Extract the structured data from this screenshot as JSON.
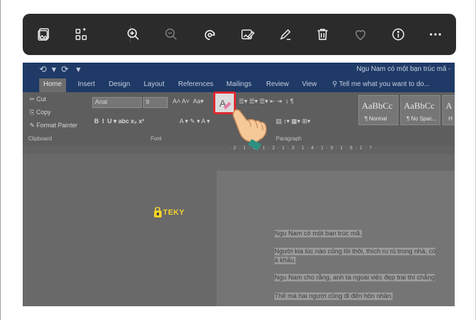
{
  "viewer": {
    "toolbar": {
      "buttons": [
        {
          "name": "image-icon",
          "label": "Image"
        },
        {
          "name": "collection-icon",
          "label": "Add to album"
        },
        {
          "name": "zoom-in-icon",
          "label": "Zoom in"
        },
        {
          "name": "zoom-out-icon",
          "label": "Zoom out"
        },
        {
          "name": "rotate-icon",
          "label": "Rotate"
        },
        {
          "name": "edit-image-icon",
          "label": "Edit image"
        },
        {
          "name": "draw-icon",
          "label": "Draw"
        },
        {
          "name": "delete-icon",
          "label": "Delete"
        },
        {
          "name": "heart-icon",
          "label": "Favorite"
        },
        {
          "name": "info-icon",
          "label": "File info"
        },
        {
          "name": "more-icon",
          "label": "See more"
        }
      ]
    }
  },
  "word": {
    "document_title": "Ngu Nam có một bạn trúc mã -",
    "tabs": [
      "Home",
      "Insert",
      "Design",
      "Layout",
      "References",
      "Mailings",
      "Review",
      "View"
    ],
    "tell_me": "Tell me what you want to do...",
    "clipboard": {
      "cut": "Cut",
      "copy": "Copy",
      "format_painter": "Format Painter",
      "group": "Clipboard"
    },
    "font": {
      "name": "Arial",
      "size": "9",
      "group": "Font"
    },
    "paragraph_group": "Paragraph",
    "styles": [
      {
        "sample": "AaBbCc",
        "name": "¶ Normal"
      },
      {
        "sample": "AaBbCc",
        "name": "¶ No Spac..."
      },
      {
        "sample": "A",
        "name": "H"
      }
    ],
    "ruler_marks": "· 2 · 1 · 1 · 1 · 2 · 1 · 3 · 1 · 4 · 1 · 5 · 1 · 6 · 1 · 7 ·",
    "document_lines": [
      "Ngu Nam có một bạn trúc mã.",
      "Người kia lúc nào cũng lôi thôi, thích ru rú trong nhà, có",
      "ả khẩu.",
      "Ngu Nam cho rằng, anh ta ngoài việc đẹp trai thì chẳng",
      "Thế mà hai người cũng đi đến hôn nhân."
    ]
  },
  "watermark": {
    "text": "TEKY"
  },
  "colors": {
    "highlight_border": "#e0282e",
    "toolbar_bg": "#2b2b2b",
    "word_titlebar": "#1f3a66"
  }
}
